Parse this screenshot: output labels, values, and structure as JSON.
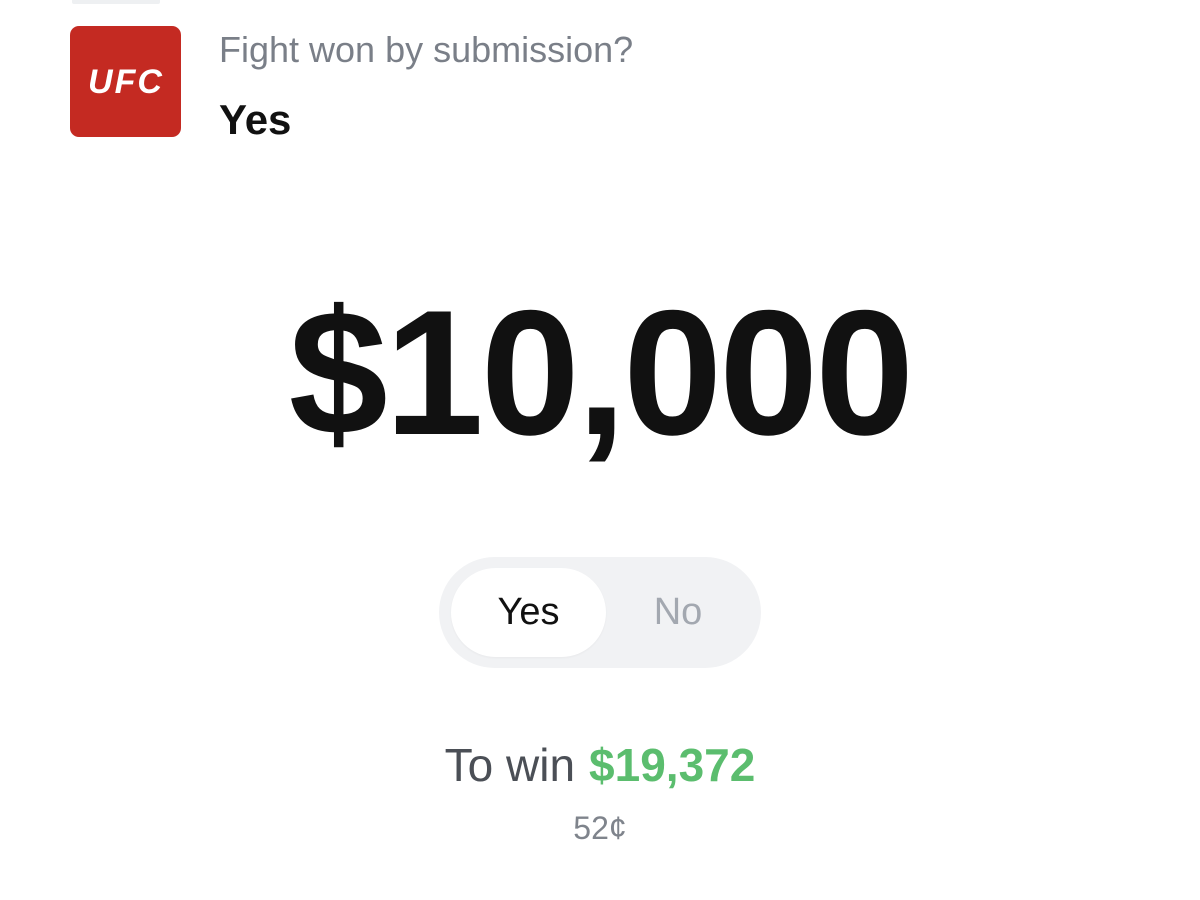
{
  "market": {
    "logo_text": "UFC",
    "question": "Fight won by submission?",
    "outcome": "Yes"
  },
  "order": {
    "amount": "$10,000",
    "toggle": {
      "yes_label": "Yes",
      "no_label": "No",
      "selected": "Yes"
    },
    "to_win_label": "To win",
    "to_win_value": "$19,372",
    "price": "52¢"
  },
  "colors": {
    "brand_red": "#c42a22",
    "win_green": "#5bbd6e",
    "muted_text": "#7a7f88",
    "toggle_track": "#f1f2f4"
  }
}
